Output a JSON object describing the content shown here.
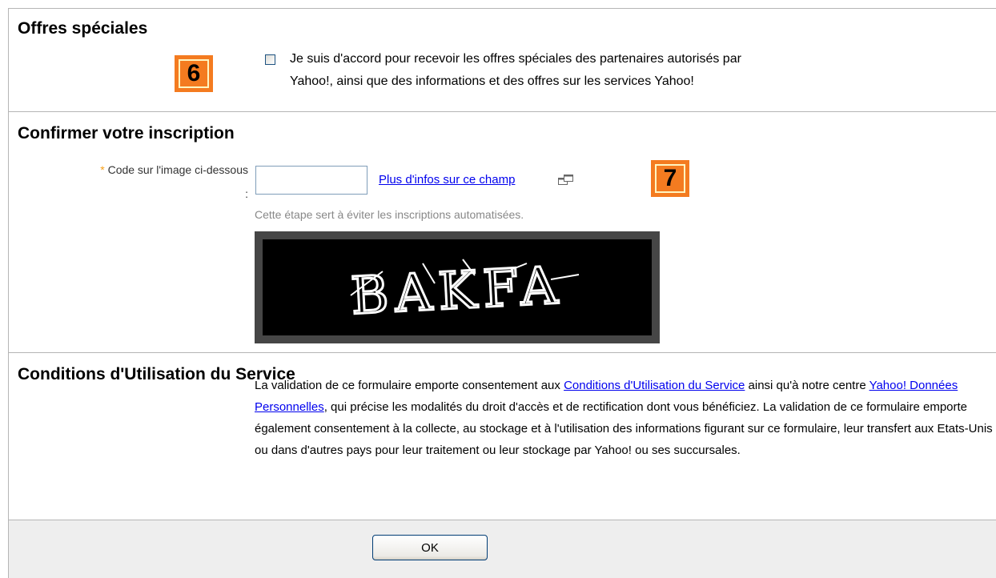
{
  "offers": {
    "title": "Offres spéciales",
    "badge": "6",
    "checkbox_checked": false,
    "line1": "Je suis d'accord pour recevoir les offres spéciales des partenaires autorisés par",
    "line2": "Yahoo!, ainsi que des informations et des offres sur les services Yahoo!"
  },
  "confirm": {
    "title": "Confirmer votre inscription",
    "required_mark": "*",
    "label": "Code sur l'image ci-dessous",
    "label_colon": ":",
    "input_value": "",
    "help_link": "Plus d'infos sur ce champ",
    "badge": "7",
    "hint": "Cette étape sert à éviter les inscriptions automatisées.",
    "captcha_text": "BAKFA"
  },
  "terms": {
    "title": "Conditions d'Utilisation du Service",
    "text_1": "La validation de ce formulaire emporte consentement aux ",
    "link_1": "Conditions d'Utilisation du Service",
    "text_2": " ainsi qu'à notre centre ",
    "link_2": "Yahoo! Données Personnelles",
    "text_3": ", qui précise les modalités du droit d'accès et de rectification dont vous bénéficiez. La validation de ce formulaire emporte également consentement à la collecte, au stockage et à l'utilisation des informations figurant sur ce formulaire, leur transfert aux Etats-Unis ou dans d'autres pays pour leur traitement ou leur stockage par Yahoo! ou ses succursales."
  },
  "footer": {
    "ok_label": "OK"
  },
  "colors": {
    "badge": "#f47b20",
    "link": "#0000ee",
    "required": "#f7a019"
  }
}
